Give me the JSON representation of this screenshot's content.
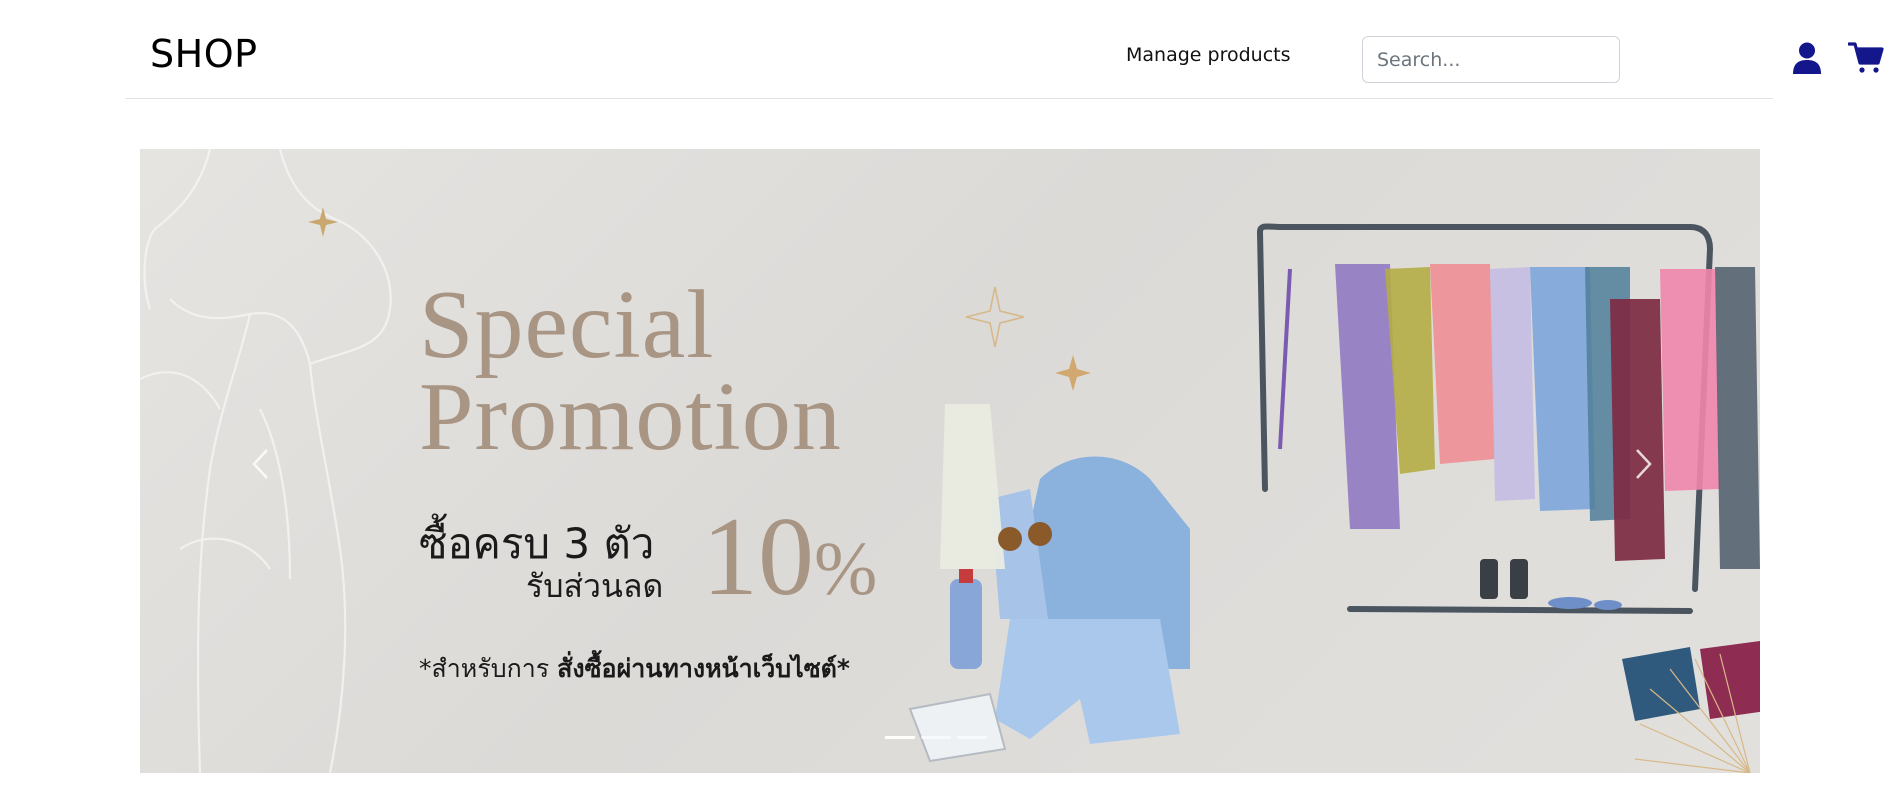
{
  "header": {
    "brand": "SHOP",
    "nav": {
      "manage_products": "Manage products"
    },
    "search": {
      "placeholder": "Search...",
      "value": ""
    },
    "icons": {
      "user": "user-icon",
      "cart": "cart-icon"
    },
    "accent_color": "#14168c"
  },
  "carousel": {
    "slide": {
      "title_line1": "Special",
      "title_line2": "Promotion",
      "offer_line1": "ซื้อครบ 3 ตัว",
      "offer_line2": "รับส่วนลด",
      "discount_number": "10",
      "discount_symbol": "%",
      "note_prefix": "*สำหรับการ ",
      "note_bold": "สั่งซื้อผ่านทางหน้าเว็บไซต์*"
    },
    "indicators": 3,
    "active_indicator": 1,
    "colors": {
      "title": "#a89584",
      "background": "#e2e0dd"
    }
  }
}
